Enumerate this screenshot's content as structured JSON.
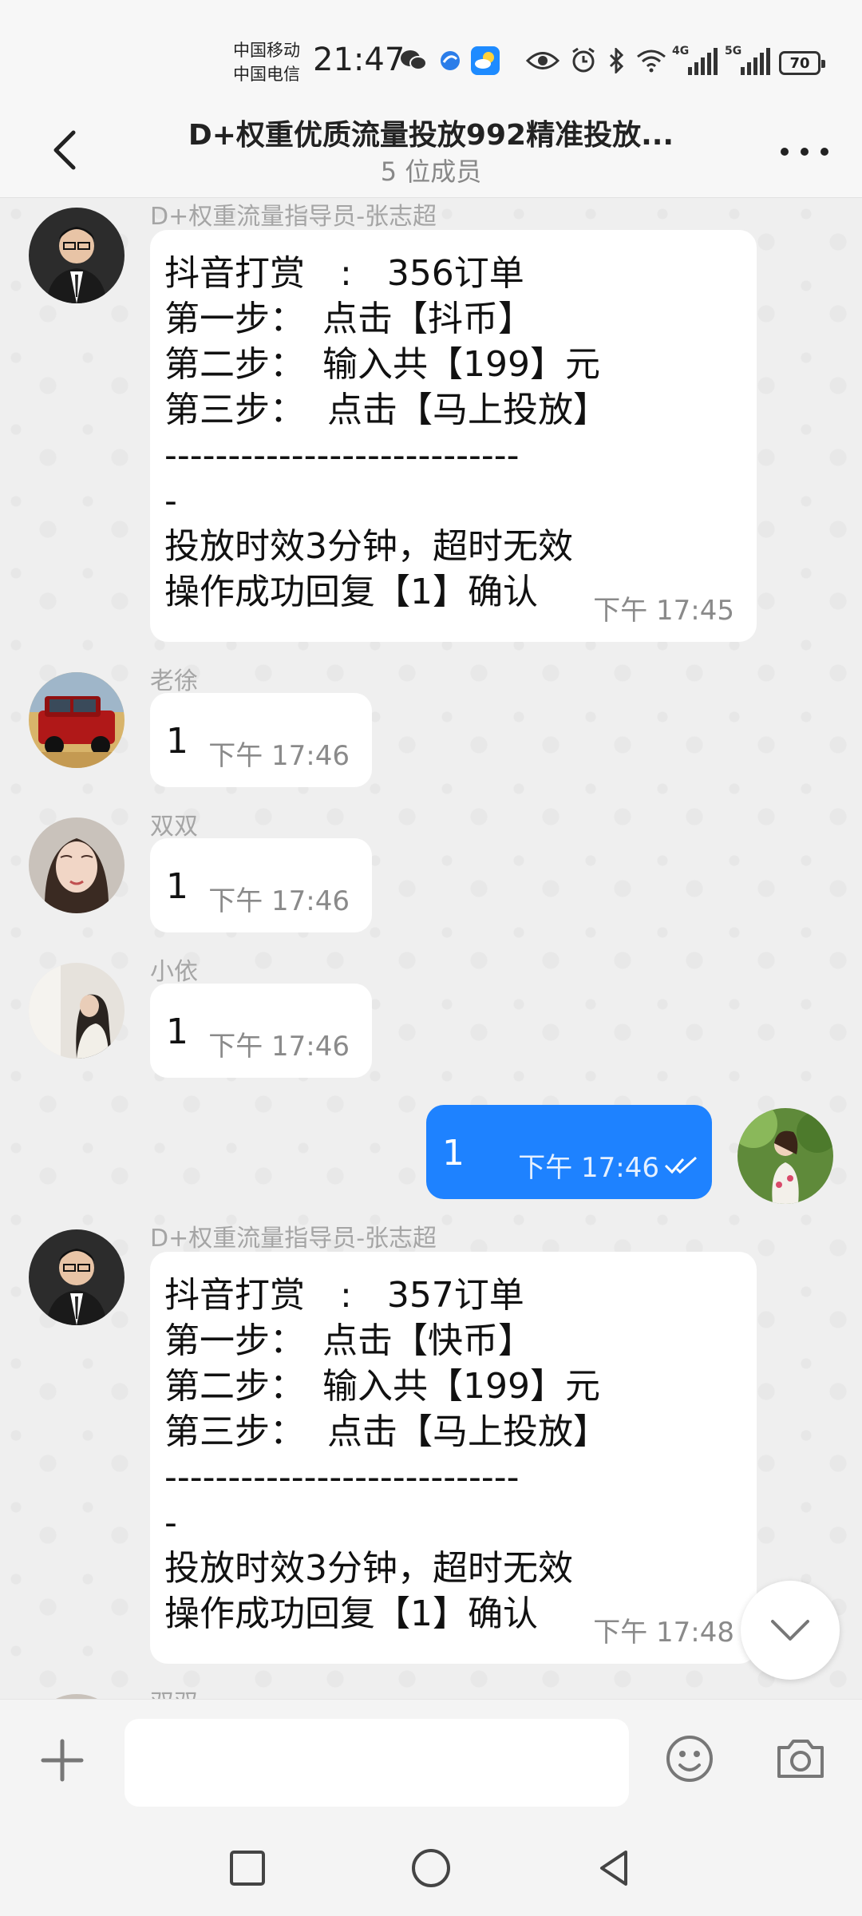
{
  "status_bar": {
    "carrier_1": "中国移动",
    "carrier_2": "中国电信",
    "time": "21:47",
    "network_1": "4G",
    "network_2": "5G",
    "battery": "70",
    "icons": [
      "wechat-icon",
      "browser-icon",
      "weather-icon",
      "eye-icon",
      "alarm-icon",
      "bluetooth-icon",
      "wifi-icon",
      "signal-icon",
      "battery-icon"
    ]
  },
  "header": {
    "title": "D+权重优质流量投放992精准投放...",
    "members": "5 位成员"
  },
  "messages": [
    {
      "sender": "D+权重流量指导员-张志超",
      "lines": [
        "抖音打赏　:　356订单",
        "第一步：　点击【抖币】",
        "第二步：　输入共【199】元",
        "第三步：  点击【马上投放】",
        "----------------------------",
        "-",
        "投放时效3分钟，超时无效",
        "操作成功回复【1】确认"
      ],
      "time": "下午  17:45"
    },
    {
      "sender": "老徐",
      "text": "1",
      "time": "下午  17:46"
    },
    {
      "sender": "双双",
      "text": "1",
      "time": "下午  17:46"
    },
    {
      "sender": "小依",
      "text": "1",
      "time": "下午  17:46"
    },
    {
      "sender": "",
      "text": "1",
      "time": "下午  17:46",
      "mine": true,
      "status": "read"
    },
    {
      "sender": "D+权重流量指导员-张志超",
      "lines": [
        "抖音打赏　:　357订单",
        "第一步：　点击【快币】",
        "第二步：　输入共【199】元",
        "第三步：  点击【马上投放】",
        "----------------------------",
        "-",
        "投放时效3分钟，超时无效",
        "操作成功回复【1】确认"
      ],
      "time": "下午  17:48"
    },
    {
      "sender": "双双"
    }
  ],
  "input": {
    "placeholder": "",
    "value": ""
  },
  "colors": {
    "my_bubble": "#1e82ff",
    "bubble": "#ffffff",
    "background": "#efefef",
    "sender_name": "#a5a5a5"
  }
}
